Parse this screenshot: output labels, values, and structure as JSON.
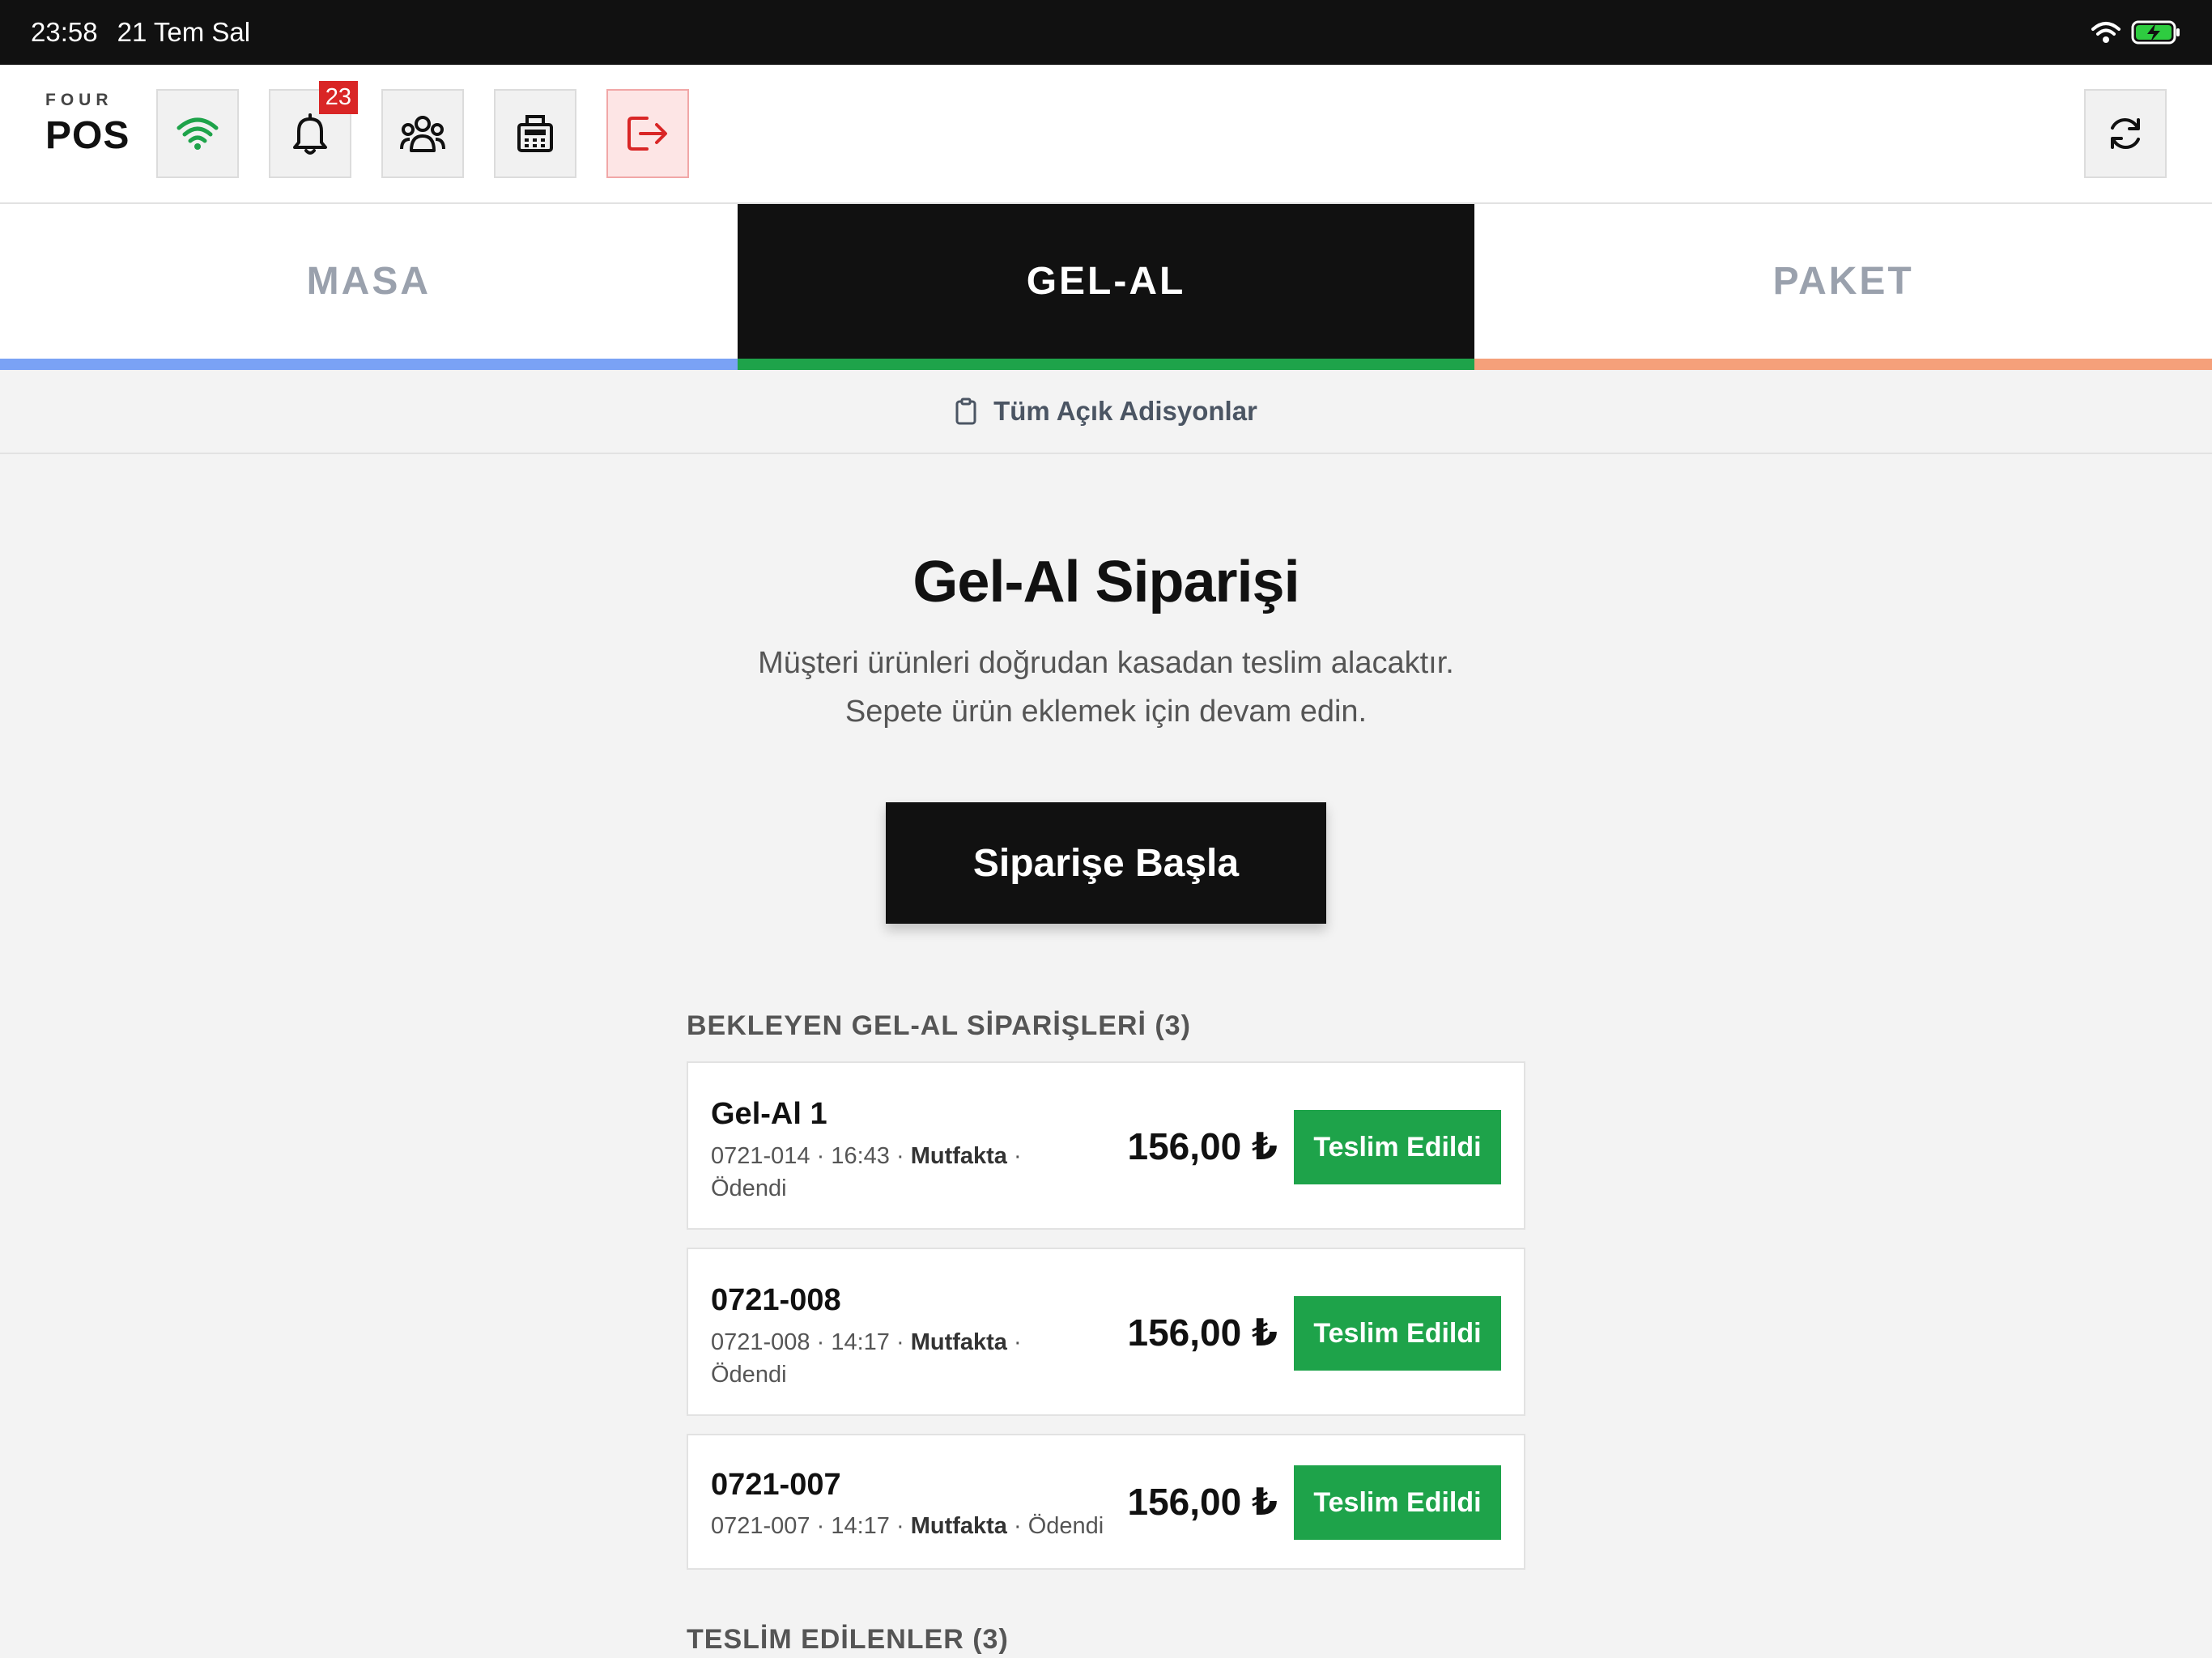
{
  "status_bar": {
    "time": "23:58",
    "date": "21 Tem Sal"
  },
  "header": {
    "logo_top": "FOUR",
    "logo_bottom": "POS",
    "notification_count": "23"
  },
  "tabs": [
    {
      "label": "MASA",
      "color": "#7aa2f5"
    },
    {
      "label": "GEL-AL",
      "color": "#1ea34a"
    },
    {
      "label": "PAKET",
      "color": "#f5a07a"
    }
  ],
  "all_open_label": "Tüm Açık Adisyonlar",
  "main": {
    "title": "Gel-Al Siparişi",
    "desc_line1": "Müşteri ürünleri doğrudan kasadan teslim alacaktır.",
    "desc_line2": "Sepete ürün eklemek için devam edin.",
    "start_button": "Siparişe Başla"
  },
  "pending_header": "BEKLEYEN GEL-AL SİPARİŞLERİ (3)",
  "pending_orders": [
    {
      "name": "Gel-Al 1",
      "code": "0721-014",
      "time": "16:43",
      "location": "Mutfakta",
      "status": "Ödendi",
      "price": "156,00 ₺",
      "button": "Teslim Edildi"
    },
    {
      "name": "0721-008",
      "code": "0721-008",
      "time": "14:17",
      "location": "Mutfakta",
      "status": "Ödendi",
      "price": "156,00 ₺",
      "button": "Teslim Edildi"
    },
    {
      "name": "0721-007",
      "code": "0721-007",
      "time": "14:17",
      "location": "Mutfakta",
      "status": "Ödendi",
      "price": "156,00 ₺",
      "button": "Teslim Edildi"
    }
  ],
  "delivered_header": "TESLİM EDİLENLER (3)",
  "colors": {
    "accent_green": "#1ea34a",
    "danger": "#d92626"
  }
}
